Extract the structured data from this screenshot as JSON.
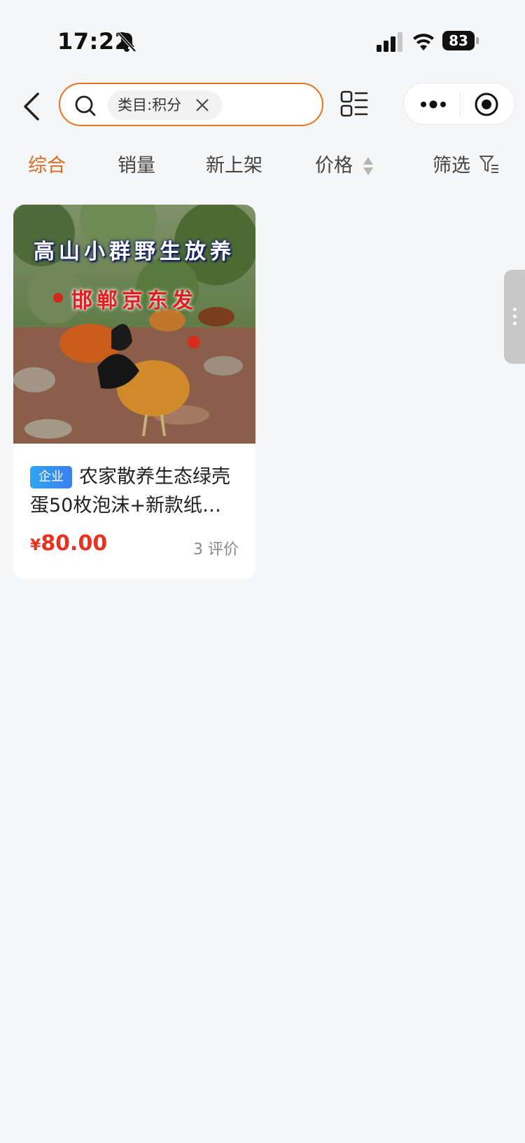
{
  "status_bar": {
    "time": "17:22",
    "battery": "83"
  },
  "search": {
    "chip_label": "类目:积分"
  },
  "sort_tabs": [
    {
      "label": "综合",
      "active": true
    },
    {
      "label": "销量",
      "active": false
    },
    {
      "label": "新上架",
      "active": false
    },
    {
      "label": "价格",
      "active": false
    },
    {
      "label": "筛选",
      "active": false
    }
  ],
  "product": {
    "image_text_line1": "高山小群野生放养",
    "image_text_line2": "邯郸京东发",
    "badge": "企业",
    "title": "农家散养生态绿壳蛋50枚泡沫+新款纸…",
    "currency": "¥",
    "price": "80.00",
    "reviews": "3 评价"
  },
  "icons": [
    "back-icon",
    "search-icon",
    "close-icon",
    "list-view-icon",
    "more-icon",
    "target-icon",
    "sort-arrows-icon",
    "filter-icon",
    "bell-off-icon",
    "signal-icon",
    "wifi-icon"
  ],
  "colors": {
    "accent": "#e06a23",
    "price": "#e8321f",
    "badge": "#2f8ff2",
    "background": "#f5f6f8"
  }
}
